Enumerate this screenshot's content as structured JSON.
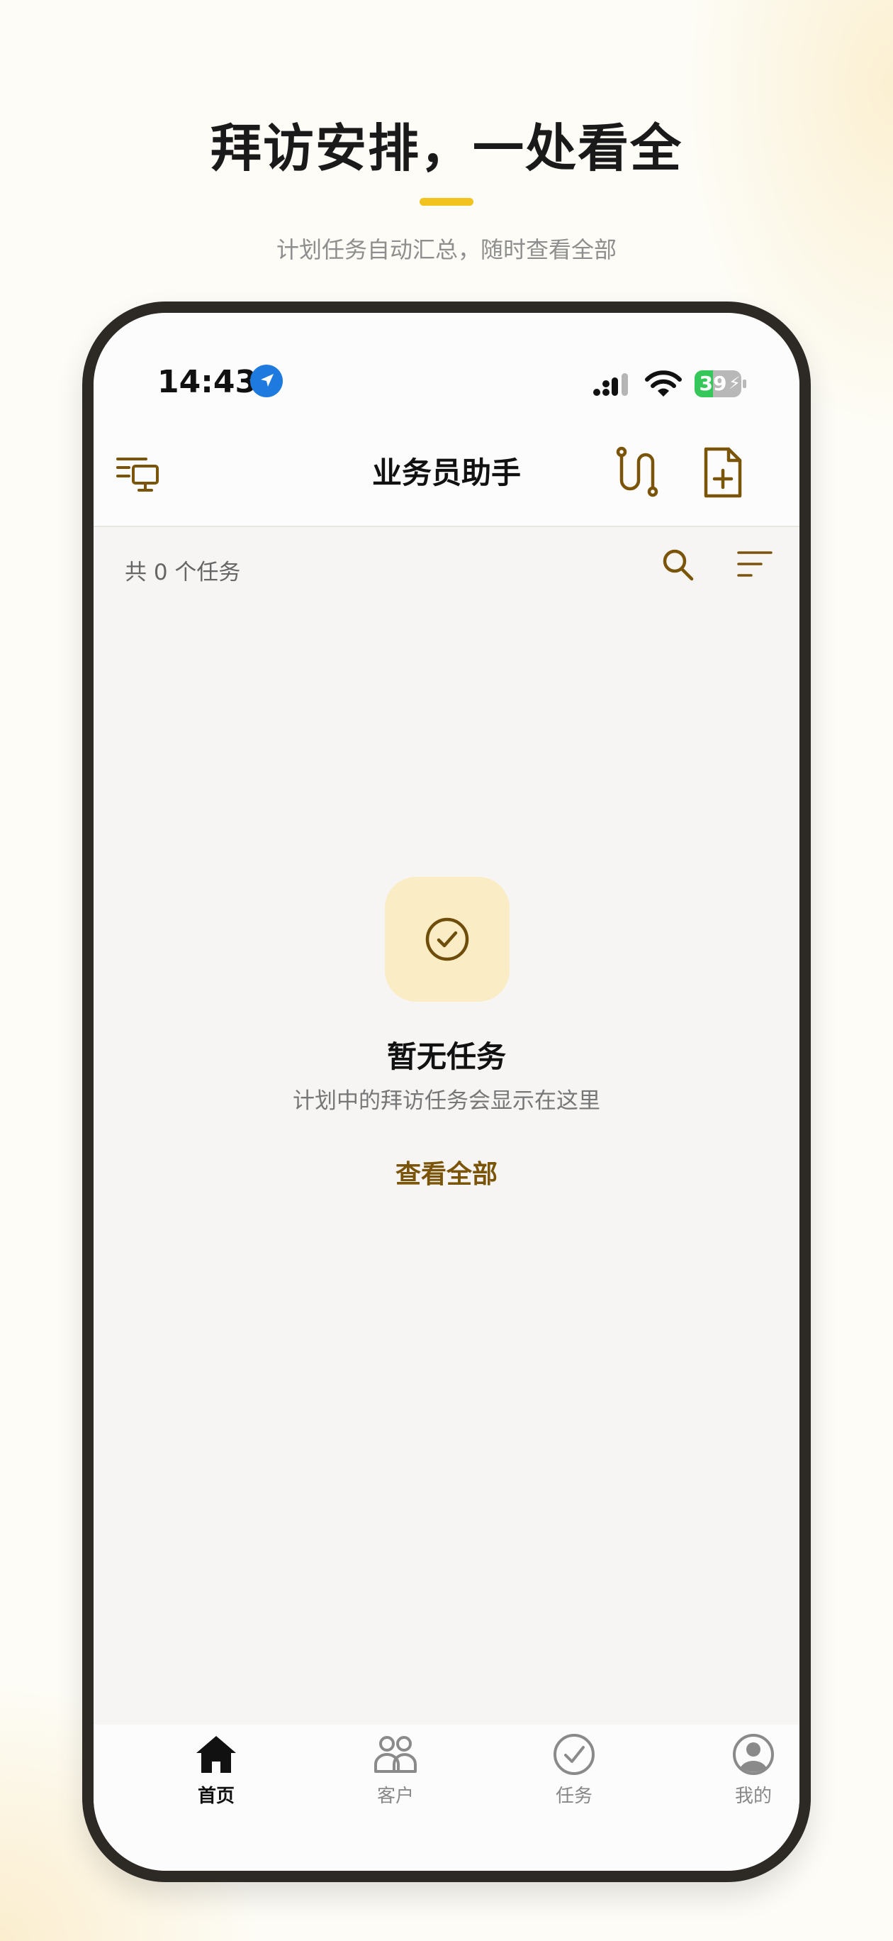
{
  "promo": {
    "headline": "拜访安排，一处看全",
    "subtitle": "计划任务自动汇总，随时查看全部",
    "accent_color": "#f2c21f"
  },
  "status_bar": {
    "time": "14:43",
    "battery_percent": "39",
    "battery_level": 0.39,
    "icons": [
      "location-arrow-icon",
      "signal-icon",
      "wifi-icon",
      "battery-charging-icon"
    ]
  },
  "nav": {
    "title": "业务员助手",
    "left_icon": "device-switch-icon",
    "right_icons": [
      "route-icon",
      "new-document-icon"
    ]
  },
  "toolbar": {
    "task_count": "共 0 个任务",
    "icons": [
      "search-icon",
      "sort-filter-icon"
    ]
  },
  "empty_state": {
    "icon": "check-circle-icon",
    "title": "暂无任务",
    "description": "计划中的拜访任务会显示在这里",
    "action_label": "查看全部"
  },
  "tabs": [
    {
      "label": "首页",
      "icon": "home-icon",
      "active": true
    },
    {
      "label": "客户",
      "icon": "customers-icon",
      "active": false
    },
    {
      "label": "任务",
      "icon": "task-check-icon",
      "active": false
    },
    {
      "label": "我的",
      "icon": "profile-icon",
      "active": false
    }
  ],
  "colors": {
    "brand": "#7a5408",
    "badge_bg": "#faecc4",
    "battery_green": "#35c759",
    "location_blue": "#1f7ae0"
  }
}
